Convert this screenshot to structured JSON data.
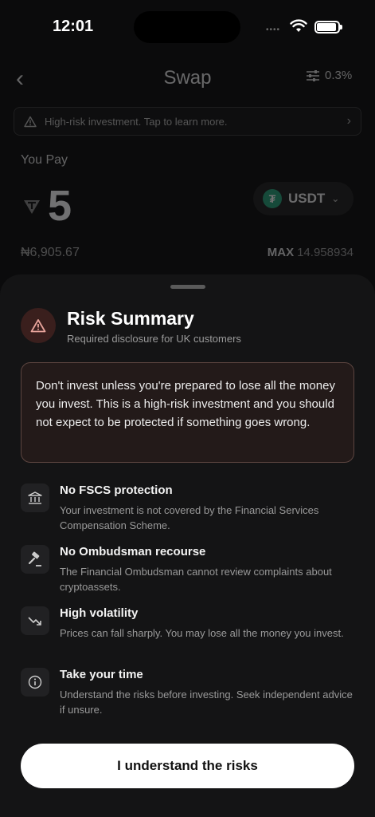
{
  "status_bar": {
    "time": "12:01",
    "dots": "••••"
  },
  "header": {
    "title": "Swap",
    "slippage": "0.3%"
  },
  "warning_bar": {
    "text": "High-risk investment. Tap to learn more."
  },
  "swap": {
    "you_pay_label": "You Pay",
    "amount": "5",
    "token_symbol": "USDT",
    "fiat_value": "₦6,905.67",
    "max_label": "MAX",
    "max_value": "14.958934"
  },
  "sheet": {
    "title": "Risk Summary",
    "subtitle": "Required disclosure for UK customers",
    "disclosure": "Don't invest unless you're prepared to lose all the money you invest. This is a high-risk investment and you should not expect to be protected if something goes wrong.",
    "items": [
      {
        "icon": "bank-icon",
        "title": "No FSCS protection",
        "desc": "Your investment is not covered by the Financial Services Compensation Scheme."
      },
      {
        "icon": "gavel-icon",
        "title": "No Ombudsman recourse",
        "desc": "The Financial Ombudsman cannot review complaints about cryptoassets."
      },
      {
        "icon": "trend-down-icon",
        "title": "High volatility",
        "desc": "Prices can fall sharply. You may lose all the money you invest."
      },
      {
        "icon": "info-icon",
        "title": "Take your time",
        "desc": "Understand the risks before investing. Seek independent advice if unsure."
      }
    ],
    "cta_label": "I understand the risks"
  },
  "colors": {
    "accent_warning": "#e8a49b",
    "tether": "#26a17b",
    "sheet_bg": "#141415"
  }
}
